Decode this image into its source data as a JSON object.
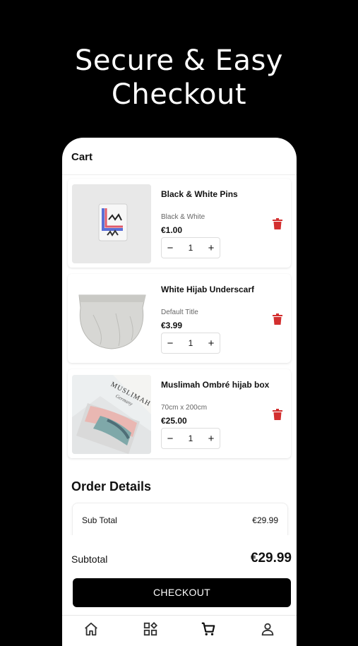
{
  "hero": {
    "line1": "Secure & Easy",
    "line2": "Checkout"
  },
  "cart": {
    "title": "Cart",
    "items": [
      {
        "name": "Black & White Pins",
        "variant": "Black & White",
        "price": "€1.00",
        "quantity": "1"
      },
      {
        "name": "White Hijab Underscarf",
        "variant": "Default Title",
        "price": "€3.99",
        "quantity": "1"
      },
      {
        "name": "Muslimah Ombré hijab box",
        "variant": "70cm x 200cm",
        "price": "€25.00",
        "quantity": "1",
        "box_brand": "MUSLIMAH",
        "box_sub": "Germany"
      }
    ],
    "stepper": {
      "minus": "−",
      "plus": "+"
    }
  },
  "order": {
    "title": "Order Details",
    "subtotal_label": "Sub Total",
    "subtotal_value": "€29.99"
  },
  "footer": {
    "total_label": "Subtotal",
    "total_value": "€29.99",
    "checkout_label": "CHECKOUT"
  },
  "tabs": [
    {
      "icon": "home-icon"
    },
    {
      "icon": "categories-icon"
    },
    {
      "icon": "cart-icon",
      "active": true
    },
    {
      "icon": "profile-icon"
    }
  ],
  "colors": {
    "delete": "#d32f2f",
    "primary": "#000000",
    "background": "#000000"
  }
}
